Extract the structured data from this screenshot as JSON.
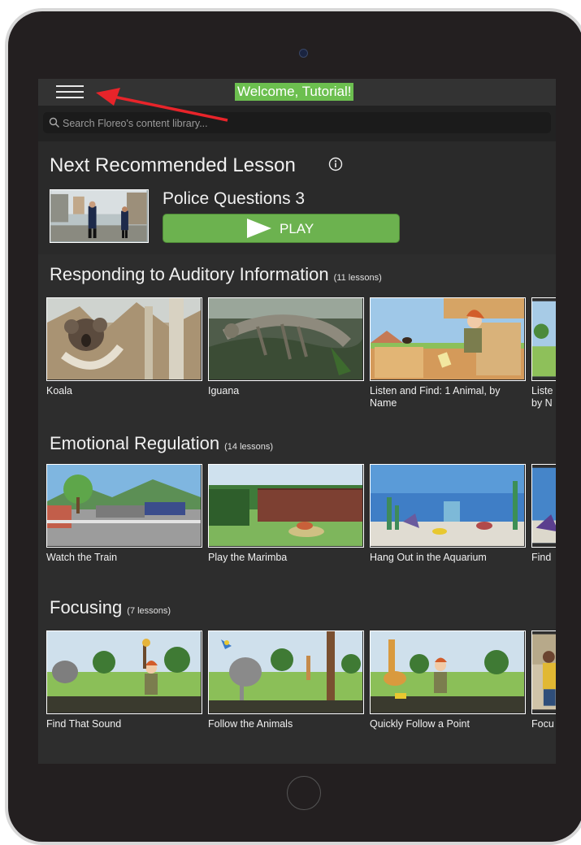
{
  "header": {
    "welcome": "Welcome, Tutorial!"
  },
  "search": {
    "placeholder": "Search Floreo's content library..."
  },
  "recommended": {
    "title": "Next Recommended Lesson",
    "lesson": "Police Questions 3",
    "play_label": "PLAY"
  },
  "sections": [
    {
      "title": "Responding to Auditory Information",
      "count": "(11 lessons)",
      "lessons": [
        {
          "label": "Koala"
        },
        {
          "label": "Iguana"
        },
        {
          "label": "Listen and Find: 1 Animal, by Name"
        },
        {
          "label": "Liste by N"
        }
      ]
    },
    {
      "title": "Emotional Regulation",
      "count": "(14 lessons)",
      "lessons": [
        {
          "label": "Watch the Train"
        },
        {
          "label": "Play the Marimba"
        },
        {
          "label": "Hang Out in the Aquarium"
        },
        {
          "label": "Find"
        }
      ]
    },
    {
      "title": "Focusing",
      "count": "(7 lessons)",
      "lessons": [
        {
          "label": "Find That Sound"
        },
        {
          "label": "Follow the Animals"
        },
        {
          "label": "Quickly Follow a Point"
        },
        {
          "label": "Focu"
        }
      ]
    }
  ],
  "colors": {
    "accent_green": "#6cb24f",
    "background": "#2d2d2d",
    "arrow": "#e8242a"
  },
  "icons": [
    "hamburger-menu-icon",
    "search-icon",
    "info-icon",
    "play-icon"
  ]
}
